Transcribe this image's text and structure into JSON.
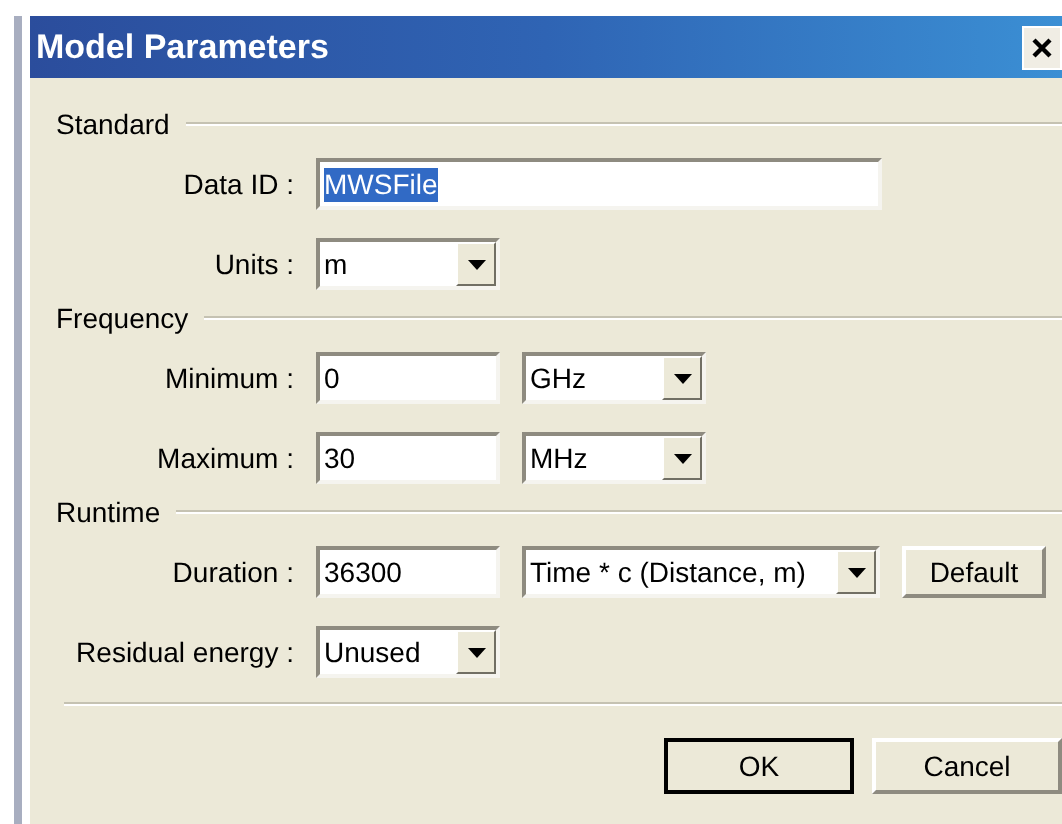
{
  "window": {
    "title": "Model Parameters"
  },
  "sections": [
    {
      "title": "Standard",
      "rows": [
        {
          "label": "Data ID :",
          "fields": [
            {
              "kind": "wide-text",
              "value": "MWSFile",
              "text_selected": true
            }
          ]
        },
        {
          "label": "Units :",
          "fields": [
            {
              "kind": "dropdown",
              "value": "m"
            }
          ]
        }
      ]
    },
    {
      "title": "Frequency",
      "rows": [
        {
          "label": "Minimum :",
          "fields": [
            {
              "kind": "text",
              "value": "0",
              "text_selected": false
            },
            {
              "kind": "dropdown",
              "value": "GHz"
            }
          ]
        },
        {
          "label": "Maximum :",
          "fields": [
            {
              "kind": "text",
              "value": "30",
              "text_selected": false
            },
            {
              "kind": "dropdown",
              "value": "MHz"
            }
          ]
        }
      ]
    },
    {
      "title": "Runtime",
      "rows": [
        {
          "label": "Duration :",
          "fields": [
            {
              "kind": "text",
              "value": "36300",
              "text_selected": false
            },
            {
              "kind": "wide-dropdown",
              "value": "Time * c (Distance, m)"
            },
            {
              "kind": "button",
              "value": "Default"
            }
          ]
        },
        {
          "label": "Residual energy :",
          "fields": [
            {
              "kind": "dropdown",
              "value": "Unused"
            }
          ]
        }
      ]
    }
  ],
  "buttons": [
    {
      "label": "OK",
      "default": true
    },
    {
      "label": "Cancel",
      "default": false
    }
  ]
}
